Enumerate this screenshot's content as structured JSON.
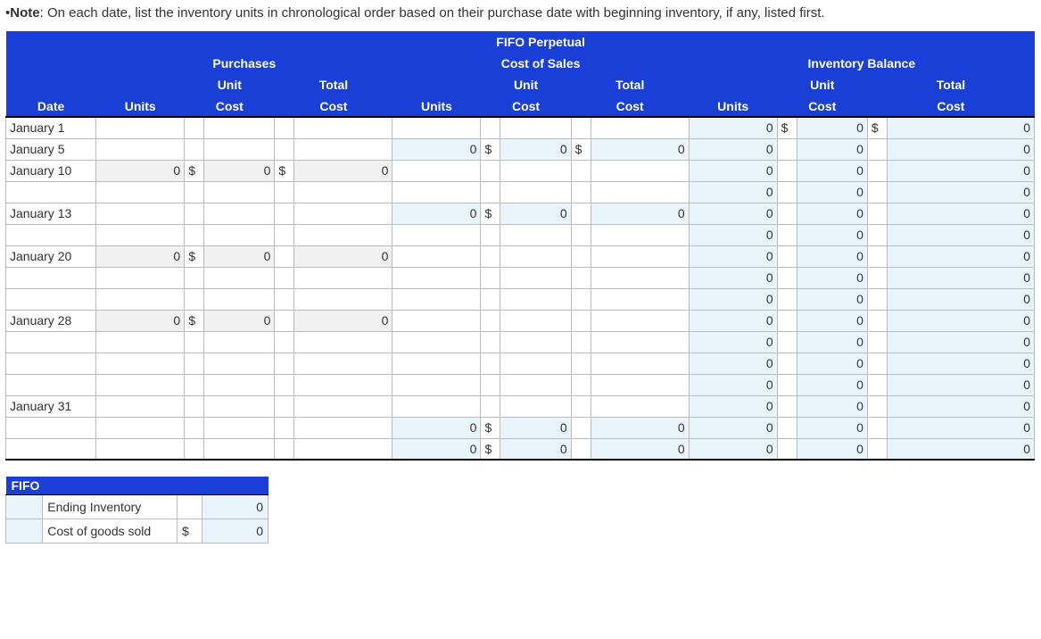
{
  "note_label": "Note",
  "note_text": ": On each date, list the inventory units in chronological order based on their purchase date with beginning inventory, if any, listed first.",
  "headers": {
    "purchases": "Purchases",
    "fifo_top": "FIFO Perpetual",
    "cos": "Cost of Sales",
    "inv": "Inventory Balance",
    "unit_cost": "Unit Cost",
    "total_cost": "Total Cost",
    "unit": "Unit",
    "cost": "Cost",
    "total": "Total",
    "date": "Date",
    "units": "Units"
  },
  "rows": [
    {
      "date": "January 1",
      "p_units": "",
      "p_d": "",
      "p_uc": "",
      "p_d2": "",
      "p_tc": "",
      "c_units": "",
      "c_d": "",
      "c_uc": "",
      "c_d2": "",
      "c_tc": "",
      "i_units": "0",
      "i_d": "$",
      "i_uc": "0",
      "i_d2": "$",
      "i_tc": "0",
      "p_fill": false,
      "c_fill": false,
      "i_fill": true
    },
    {
      "date": "January 5",
      "p_units": "",
      "p_d": "",
      "p_uc": "",
      "p_d2": "",
      "p_tc": "",
      "c_units": "0",
      "c_d": "$",
      "c_uc": "0",
      "c_d2": "$",
      "c_tc": "0",
      "i_units": "0",
      "i_d": "",
      "i_uc": "0",
      "i_d2": "",
      "i_tc": "0",
      "p_fill": false,
      "c_fill": true,
      "i_fill": true
    },
    {
      "date": "January 10",
      "p_units": "0",
      "p_d": "$",
      "p_uc": "0",
      "p_d2": "$",
      "p_tc": "0",
      "c_units": "",
      "c_d": "",
      "c_uc": "",
      "c_d2": "",
      "c_tc": "",
      "i_units": "0",
      "i_d": "",
      "i_uc": "0",
      "i_d2": "",
      "i_tc": "0",
      "p_fill": true,
      "c_fill": false,
      "i_fill": true
    },
    {
      "date": "",
      "p_units": "",
      "p_d": "",
      "p_uc": "",
      "p_d2": "",
      "p_tc": "",
      "c_units": "",
      "c_d": "",
      "c_uc": "",
      "c_d2": "",
      "c_tc": "",
      "i_units": "0",
      "i_d": "",
      "i_uc": "0",
      "i_d2": "",
      "i_tc": "0",
      "p_fill": false,
      "c_fill": false,
      "i_fill": true
    },
    {
      "date": "January 13",
      "p_units": "",
      "p_d": "",
      "p_uc": "",
      "p_d2": "",
      "p_tc": "",
      "c_units": "0",
      "c_d": "$",
      "c_uc": "0",
      "c_d2": "",
      "c_tc": "0",
      "i_units": "0",
      "i_d": "",
      "i_uc": "0",
      "i_d2": "",
      "i_tc": "0",
      "p_fill": false,
      "c_fill": true,
      "i_fill": true
    },
    {
      "date": "",
      "p_units": "",
      "p_d": "",
      "p_uc": "",
      "p_d2": "",
      "p_tc": "",
      "c_units": "",
      "c_d": "",
      "c_uc": "",
      "c_d2": "",
      "c_tc": "",
      "i_units": "0",
      "i_d": "",
      "i_uc": "0",
      "i_d2": "",
      "i_tc": "0",
      "p_fill": false,
      "c_fill": false,
      "i_fill": true
    },
    {
      "date": "January 20",
      "p_units": "0",
      "p_d": "$",
      "p_uc": "0",
      "p_d2": "",
      "p_tc": "0",
      "c_units": "",
      "c_d": "",
      "c_uc": "",
      "c_d2": "",
      "c_tc": "",
      "i_units": "0",
      "i_d": "",
      "i_uc": "0",
      "i_d2": "",
      "i_tc": "0",
      "p_fill": true,
      "c_fill": false,
      "i_fill": true
    },
    {
      "date": "",
      "p_units": "",
      "p_d": "",
      "p_uc": "",
      "p_d2": "",
      "p_tc": "",
      "c_units": "",
      "c_d": "",
      "c_uc": "",
      "c_d2": "",
      "c_tc": "",
      "i_units": "0",
      "i_d": "",
      "i_uc": "0",
      "i_d2": "",
      "i_tc": "0",
      "p_fill": false,
      "c_fill": false,
      "i_fill": true
    },
    {
      "date": "",
      "p_units": "",
      "p_d": "",
      "p_uc": "",
      "p_d2": "",
      "p_tc": "",
      "c_units": "",
      "c_d": "",
      "c_uc": "",
      "c_d2": "",
      "c_tc": "",
      "i_units": "0",
      "i_d": "",
      "i_uc": "0",
      "i_d2": "",
      "i_tc": "0",
      "p_fill": false,
      "c_fill": false,
      "i_fill": true
    },
    {
      "date": "January 28",
      "p_units": "0",
      "p_d": "$",
      "p_uc": "0",
      "p_d2": "",
      "p_tc": "0",
      "c_units": "",
      "c_d": "",
      "c_uc": "",
      "c_d2": "",
      "c_tc": "",
      "i_units": "0",
      "i_d": "",
      "i_uc": "0",
      "i_d2": "",
      "i_tc": "0",
      "p_fill": true,
      "c_fill": false,
      "i_fill": true
    },
    {
      "date": "",
      "p_units": "",
      "p_d": "",
      "p_uc": "",
      "p_d2": "",
      "p_tc": "",
      "c_units": "",
      "c_d": "",
      "c_uc": "",
      "c_d2": "",
      "c_tc": "",
      "i_units": "0",
      "i_d": "",
      "i_uc": "0",
      "i_d2": "",
      "i_tc": "0",
      "p_fill": false,
      "c_fill": false,
      "i_fill": true
    },
    {
      "date": "",
      "p_units": "",
      "p_d": "",
      "p_uc": "",
      "p_d2": "",
      "p_tc": "",
      "c_units": "",
      "c_d": "",
      "c_uc": "",
      "c_d2": "",
      "c_tc": "",
      "i_units": "0",
      "i_d": "",
      "i_uc": "0",
      "i_d2": "",
      "i_tc": "0",
      "p_fill": false,
      "c_fill": false,
      "i_fill": true
    },
    {
      "date": "",
      "p_units": "",
      "p_d": "",
      "p_uc": "",
      "p_d2": "",
      "p_tc": "",
      "c_units": "",
      "c_d": "",
      "c_uc": "",
      "c_d2": "",
      "c_tc": "",
      "i_units": "0",
      "i_d": "",
      "i_uc": "0",
      "i_d2": "",
      "i_tc": "0",
      "p_fill": false,
      "c_fill": false,
      "i_fill": true
    },
    {
      "date": "January 31",
      "p_units": "",
      "p_d": "",
      "p_uc": "",
      "p_d2": "",
      "p_tc": "",
      "c_units": "",
      "c_d": "",
      "c_uc": "",
      "c_d2": "",
      "c_tc": "",
      "i_units": "0",
      "i_d": "",
      "i_uc": "0",
      "i_d2": "",
      "i_tc": "0",
      "p_fill": false,
      "c_fill": false,
      "i_fill": true
    },
    {
      "date": "",
      "p_units": "",
      "p_d": "",
      "p_uc": "",
      "p_d2": "",
      "p_tc": "",
      "c_units": "0",
      "c_d": "$",
      "c_uc": "0",
      "c_d2": "",
      "c_tc": "0",
      "i_units": "0",
      "i_d": "",
      "i_uc": "0",
      "i_d2": "",
      "i_tc": "0",
      "p_fill": false,
      "c_fill": true,
      "i_fill": true
    },
    {
      "date": "",
      "p_units": "",
      "p_d": "",
      "p_uc": "",
      "p_d2": "",
      "p_tc": "",
      "c_units": "0",
      "c_d": "$",
      "c_uc": "0",
      "c_d2": "",
      "c_tc": "0",
      "i_units": "0",
      "i_d": "",
      "i_uc": "0",
      "i_d2": "",
      "i_tc": "0",
      "p_fill": false,
      "c_fill": true,
      "i_fill": true,
      "last": true
    }
  ],
  "summary": {
    "title": "FIFO",
    "ending_label": "Ending Inventory",
    "ending_cur": "",
    "ending_val": "0",
    "cogs_label": "Cost of goods sold",
    "cogs_cur": "$",
    "cogs_val": "0"
  }
}
